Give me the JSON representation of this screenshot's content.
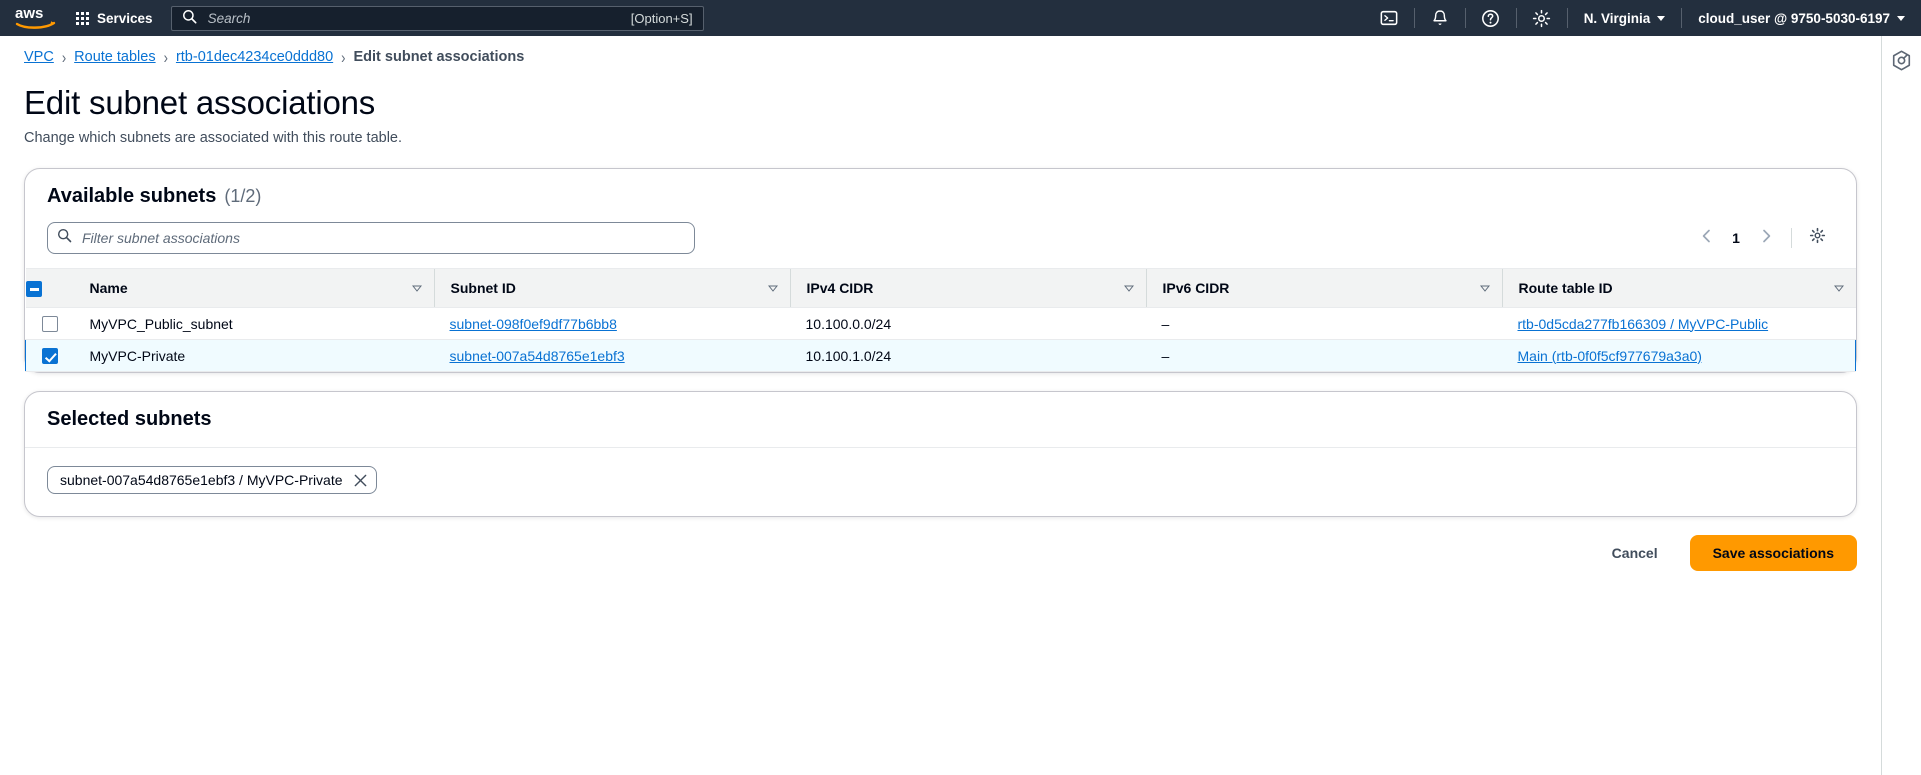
{
  "topnav": {
    "logo_alt": "aws",
    "services_label": "Services",
    "search_placeholder": "Search",
    "search_value": "",
    "search_shortcut": "[Option+S]",
    "cloudshell_icon": "cloudshell-icon",
    "notifications_icon": "bell-icon",
    "help_icon": "question-circle-icon",
    "settings_icon": "gear-icon",
    "region_label": "N. Virginia",
    "account_label": "cloud_user @ 9750-5030-6197",
    "bg_color": "#232f3e"
  },
  "breadcrumb": {
    "items": [
      {
        "label": "VPC",
        "link": true
      },
      {
        "label": "Route tables",
        "link": true
      },
      {
        "label": "rtb-01dec4234ce0ddd80",
        "link": true
      },
      {
        "label": "Edit subnet associations",
        "link": false
      }
    ],
    "separator": "›"
  },
  "header": {
    "title": "Edit subnet associations",
    "description": "Change which subnets are associated with this route table."
  },
  "available": {
    "title": "Available subnets",
    "count": "(1/2)",
    "filter_placeholder": "Filter subnet associations",
    "filter_value": "",
    "search_icon": "search-icon",
    "pagination": {
      "prev_icon": "chevron-left-icon",
      "page": "1",
      "next_icon": "chevron-right-icon"
    },
    "settings_icon": "gear-icon",
    "columns": [
      "Name",
      "Subnet ID",
      "IPv4 CIDR",
      "IPv6 CIDR",
      "Route table ID"
    ],
    "header_checkbox_state": "indeterminate",
    "rows": [
      {
        "selected": false,
        "name": "MyVPC_Public_subnet",
        "subnet_id": "subnet-098f0ef9df77b6bb8",
        "ipv4_cidr": "10.100.0.0/24",
        "ipv6_cidr": "–",
        "route_table_id": "rtb-0d5cda277fb166309 / MyVPC-Public"
      },
      {
        "selected": true,
        "name": "MyVPC-Private",
        "subnet_id": "subnet-007a54d8765e1ebf3",
        "ipv4_cidr": "10.100.1.0/24",
        "ipv6_cidr": "–",
        "route_table_id": "Main (rtb-0f0f5cf977679a3a0)"
      }
    ]
  },
  "selected_subnets": {
    "title": "Selected subnets",
    "tokens": [
      {
        "label": "subnet-007a54d8765e1ebf3 / MyVPC-Private",
        "dismiss_icon": "close-icon"
      }
    ]
  },
  "actions": {
    "cancel_label": "Cancel",
    "save_label": "Save associations",
    "save_color": "#ff9900"
  },
  "right_rail": {
    "panel_icon": "help-panel-icon"
  }
}
